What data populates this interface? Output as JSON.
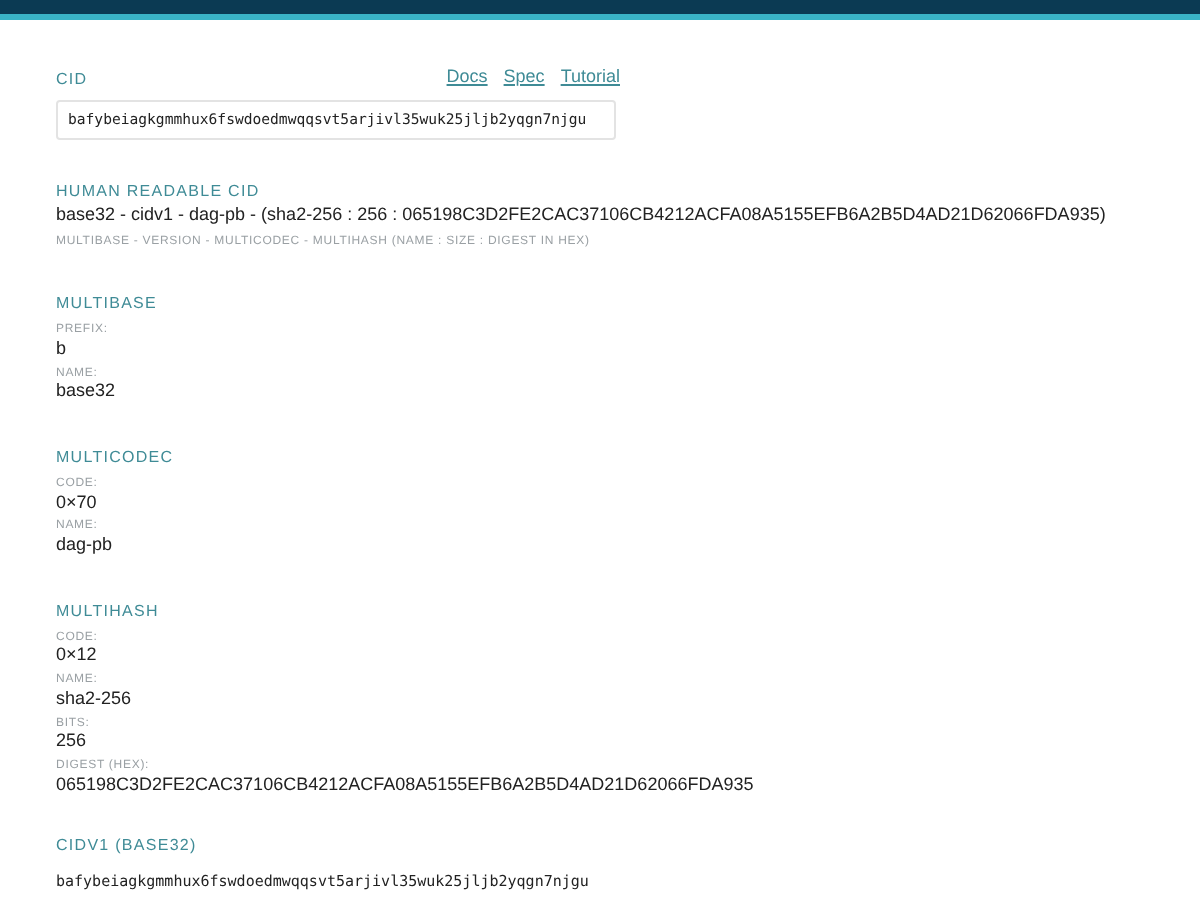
{
  "cid": {
    "label": "CID",
    "value": "bafybeiagkgmmhux6fswdoedmwqqsvt5arjivl35wuk25jljb2yqgn7njgu"
  },
  "links": [
    "Docs",
    "Spec",
    "Tutorial"
  ],
  "human_readable": {
    "heading": "HUMAN READABLE CID",
    "value": "base32 - cidv1 - dag-pb - (sha2-256 : 256 : 065198C3D2FE2CAC37106CB4212ACFA08A5155EFB6A2B5D4AD21D62066FDA935)",
    "legend": "MULTIBASE - VERSION - MULTICODEC - MULTIHASH (NAME : SIZE : DIGEST IN HEX)"
  },
  "sections": [
    {
      "heading": "MULTIBASE",
      "fields": [
        {
          "label": "PREFIX:",
          "value": "b"
        },
        {
          "label": "NAME:",
          "value": "base32"
        }
      ]
    },
    {
      "heading": "MULTICODEC",
      "fields": [
        {
          "label": "CODE:",
          "value": "0×70"
        },
        {
          "label": "NAME:",
          "value": "dag-pb"
        }
      ]
    },
    {
      "heading": "MULTIHASH",
      "fields": [
        {
          "label": "CODE:",
          "value": "0×12"
        },
        {
          "label": "NAME:",
          "value": "sha2-256"
        },
        {
          "label": "BITS:",
          "value": "256"
        },
        {
          "label": "DIGEST (HEX):",
          "value": "065198C3D2FE2CAC37106CB4212ACFA08A5155EFB6A2B5D4AD21D62066FDA935"
        }
      ]
    }
  ],
  "cidv1": {
    "heading": "CIDV1 (BASE32)",
    "value": "bafybeiagkgmmhux6fswdoedmwqqsvt5arjivl35wuk25jljb2yqgn7njgu"
  }
}
